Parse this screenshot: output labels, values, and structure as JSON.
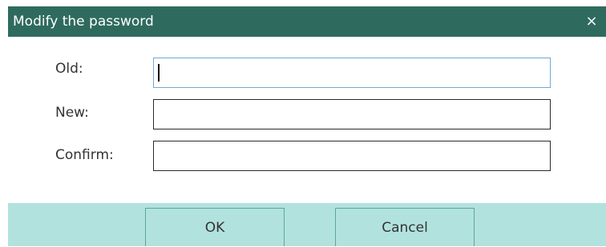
{
  "dialog": {
    "title": "Modify the password",
    "close_glyph": "×"
  },
  "form": {
    "fields": [
      {
        "label": "Old:",
        "value": "",
        "focused": true
      },
      {
        "label": "New:",
        "value": ""
      },
      {
        "label": "Confirm:",
        "value": ""
      }
    ]
  },
  "buttons": {
    "ok_label": "OK",
    "cancel_label": "Cancel"
  },
  "colors": {
    "titlebar": "#2e6b5e",
    "button_bar": "#b2e2de",
    "focused_border": "#6fa8dc"
  }
}
